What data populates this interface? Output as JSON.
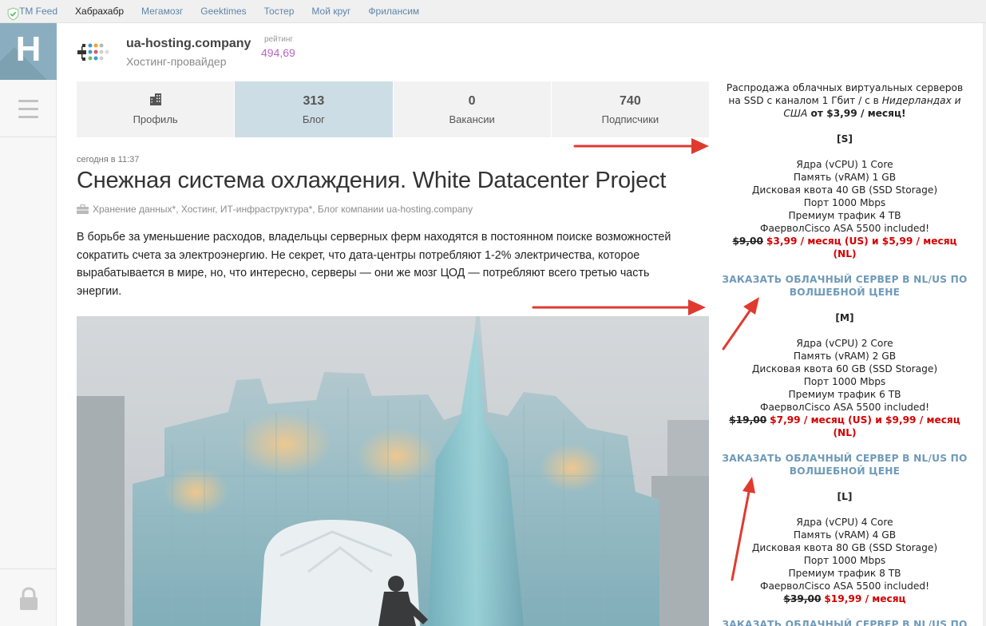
{
  "topnav": {
    "items": [
      {
        "label": "TM Feed"
      },
      {
        "label": "Хабрахабр",
        "active": true
      },
      {
        "label": "Мегамозг"
      },
      {
        "label": "Geektimes"
      },
      {
        "label": "Тостер"
      },
      {
        "label": "Мой круг"
      },
      {
        "label": "Фрилансим"
      }
    ]
  },
  "logo": {
    "letter": "H"
  },
  "company": {
    "name": "ua-hosting.company",
    "subtitle": "Хостинг-провайдер",
    "rating_label": "рейтинг",
    "rating_value": "494,69"
  },
  "tabs": [
    {
      "icon": "building-icon",
      "label": "Профиль"
    },
    {
      "num": "313",
      "label": "Блог",
      "active": true
    },
    {
      "num": "0",
      "label": "Вакансии"
    },
    {
      "num": "740",
      "label": "Подписчики"
    }
  ],
  "post": {
    "time": "сегодня в 11:37",
    "title": "Снежная система охлаждения. White Datacenter Project",
    "hubs": "Хранение данных*, Хостинг, ИТ-инфраструктура*, Блог компании ua-hosting.company",
    "text": "В борьбе за уменьшение расходов, владельцы серверных ферм находятся в постоянном поиске возможностей сократить счета за электроэнергию. Не секрет, что дата-центры потребляют 1-2% электричества, которое вырабатывается в мире, но, что интересно, серверы — они же мозг ЦОД — потребляют всего третью часть энергии."
  },
  "ad": {
    "intro_1": "Распродажа облачных виртуальных серверов на SSD с каналом 1 Гбит / с в ",
    "intro_em": "Нидерландах и США",
    "intro_2": " от $3,99 / месяц!",
    "order_label": "ЗАКАЗАТЬ ОБЛАЧНЫЙ СЕРВЕР В NL/US ПО ВОЛШЕБНОЙ ЦЕНЕ",
    "plans": [
      {
        "name": "[S]",
        "lines": [
          "Ядра (vCPU) 1 Core",
          "Память (vRAM) 1 GB",
          "Дисковая квота 40 GB (SSD Storage)",
          "Порт 1000 Mbps",
          "Премиум трафик 4 TB",
          "ФаерволCisco ASA 5500 included!"
        ],
        "old_price": "$9,00",
        "new_price": "$3,99 / месяц (US) и $5,99 / месяц (NL)"
      },
      {
        "name": "[M]",
        "lines": [
          "Ядра (vCPU) 2 Core",
          "Память (vRAM) 2 GB",
          "Дисковая квота 60 GB (SSD Storage)",
          "Порт 1000 Mbps",
          "Премиум трафик 6 TB",
          "ФаерволCisco ASA 5500 included!"
        ],
        "old_price": "$19,00",
        "new_price": "$7,99 / месяц (US) и $9,99 / месяц (NL)"
      },
      {
        "name": "[L]",
        "lines": [
          "Ядра (vCPU) 4 Core",
          "Память (vRAM) 4 GB",
          "Дисковая квота 80 GB (SSD Storage)",
          "Порт 1000 Mbps",
          "Премиум трафик 8 TB",
          "ФаерволCisco ASA 5500 included!"
        ],
        "old_price": "$39,00",
        "new_price": "$19,99 / месяц"
      }
    ]
  },
  "colors": {
    "accent": "#5b86ab",
    "logo_bg": "#8aaebf",
    "active_tab": "#cddde5",
    "price_red": "#d30000",
    "arrow_red": "#e03a2f",
    "rating": "#b469c0"
  }
}
